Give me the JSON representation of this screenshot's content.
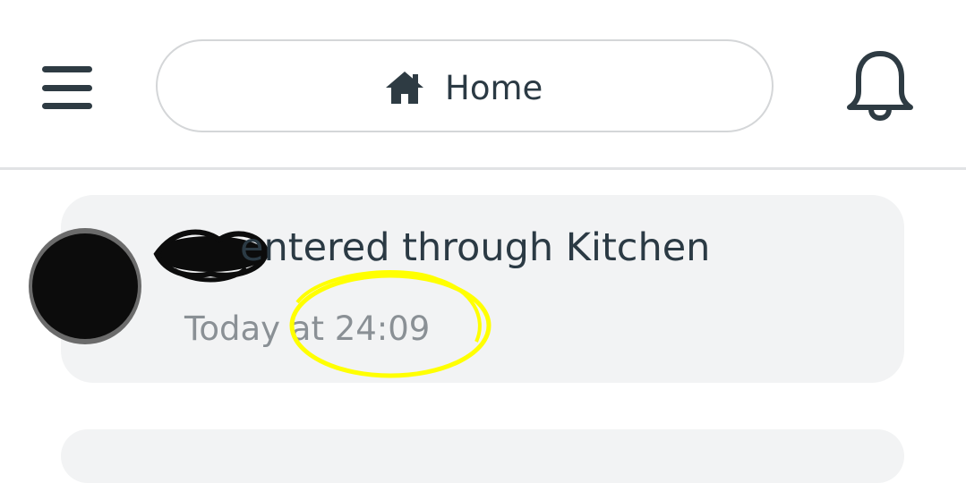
{
  "header": {
    "menu_icon": "hamburger-menu-icon",
    "home_icon": "home-icon",
    "home_label": "Home",
    "bell_icon": "bell-icon"
  },
  "notifications": [
    {
      "title": "entered through Kitchen",
      "time": "Today at 24:09"
    }
  ],
  "colors": {
    "icon": "#2e3b43",
    "text": "#2b3a44",
    "muted_text": "#8a9095",
    "card_bg": "#f2f3f4",
    "highlight": "#ffff00"
  }
}
